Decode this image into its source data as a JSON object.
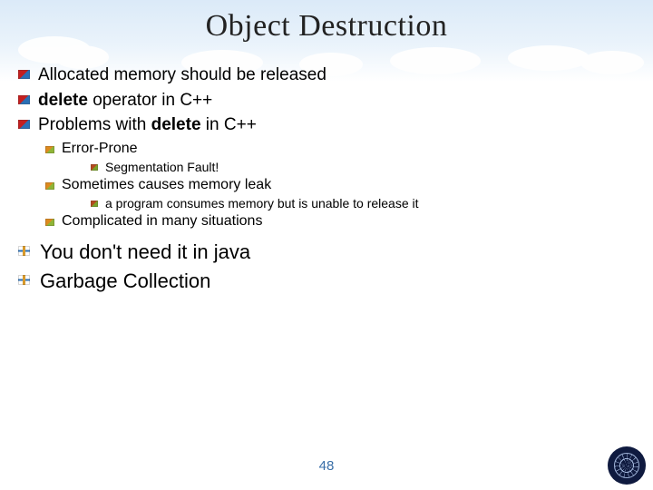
{
  "title": "Object Destruction",
  "bullets": {
    "b1_pre": "Allocated memory should be released",
    "b2_bold": "delete",
    "b2_rest": " operator in C++",
    "b3_pre": "Problems with ",
    "b3_bold": "delete",
    "b3_rest": " in C++",
    "sub1": "Error-Prone",
    "sub1a": "Segmentation Fault!",
    "sub2": "Sometimes causes memory leak",
    "sub2a": "a program consumes memory but is unable to release it",
    "sub3": "Complicated in many situations",
    "big1": "You don't need it in java",
    "big2": "Garbage Collection"
  },
  "page_number": "48"
}
